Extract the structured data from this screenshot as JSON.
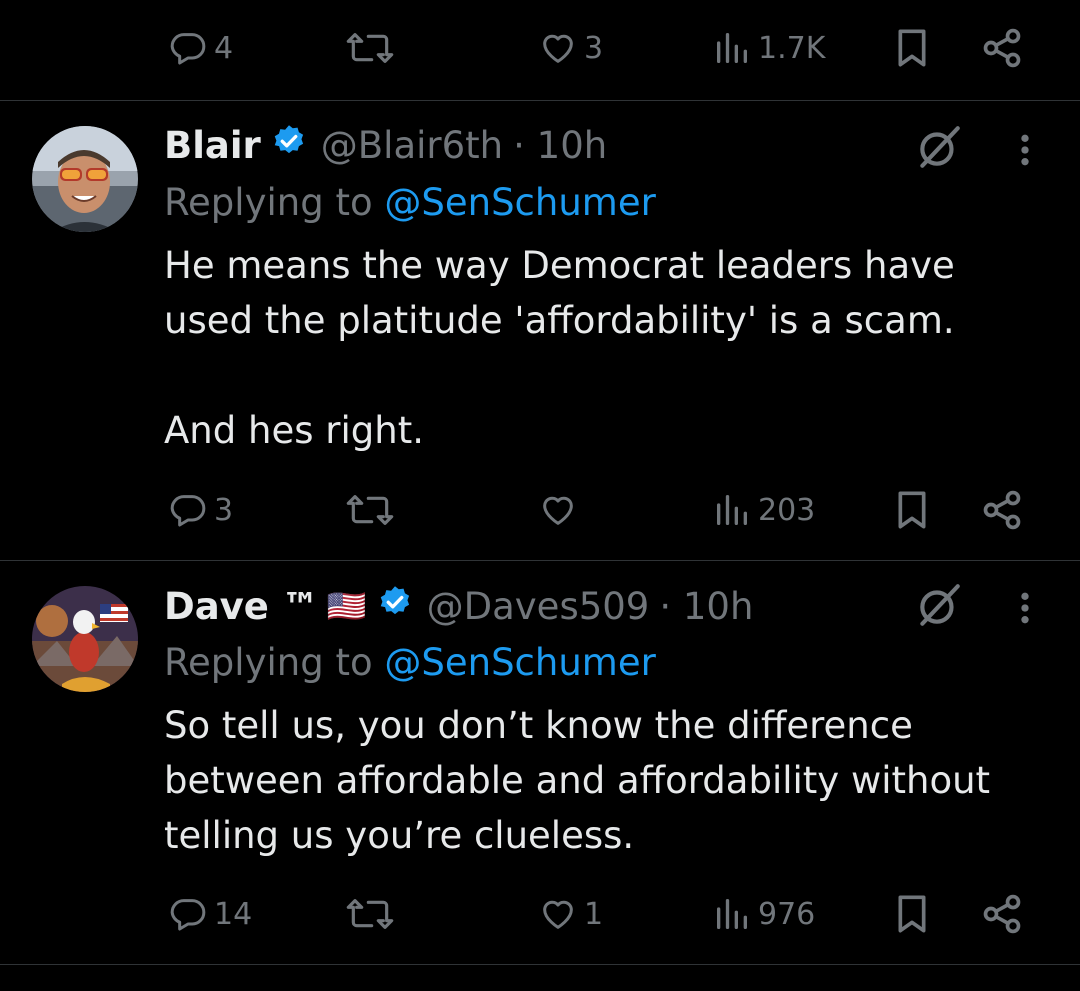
{
  "colors": {
    "background": "#000000",
    "text": "#e7e9ea",
    "muted": "#71767b",
    "link": "#1d9bf0",
    "verified": "#1d9bf0",
    "divider": "#2f3336"
  },
  "top_actions": {
    "replies": "4",
    "reposts": "",
    "likes": "3",
    "views": "1.7K"
  },
  "tweets": [
    {
      "name": "Blair",
      "handle": "@Blair6th",
      "time": "· 10h",
      "reply_prefix": "Replying to",
      "reply_to": "@SenSchumer",
      "body_line1": "He means the way Democrat leaders have used the platitude 'affordability' is a scam.",
      "body_line2": "And hes right.",
      "replies": "3",
      "reposts": "",
      "likes": "",
      "views": "203",
      "avatar_icon": "avatar-man-sunglasses"
    },
    {
      "name": "Dave ™",
      "flag": "🇺🇸",
      "handle": "@Daves509",
      "time": "· 10h",
      "reply_prefix": "Replying to",
      "reply_to": "@SenSchumer",
      "body_line1": "So tell us, you don’t know the difference between affordable and affordability without telling us you’re clueless.",
      "replies": "14",
      "reposts": "",
      "likes": "1",
      "views": "976",
      "avatar_icon": "avatar-eagle-flag"
    }
  ]
}
